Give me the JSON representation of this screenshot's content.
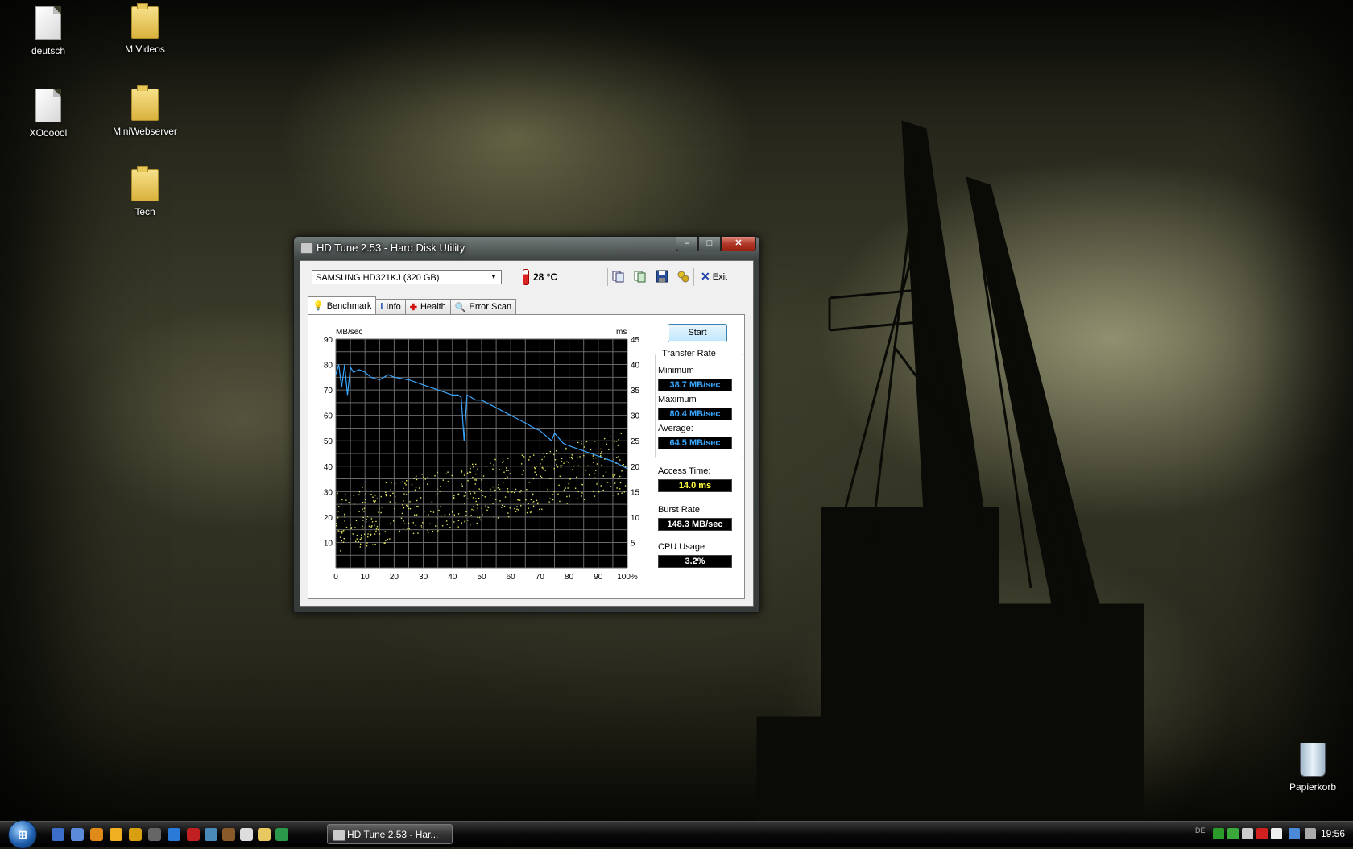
{
  "desktop": {
    "icons": [
      {
        "label": "deutsch",
        "type": "file"
      },
      {
        "label": "M Videos",
        "type": "folder"
      },
      {
        "label": "XOooool",
        "type": "file"
      },
      {
        "label": "MiniWebserver",
        "type": "folder"
      },
      {
        "label": "Tech",
        "type": "folder"
      }
    ],
    "recycle_bin": "Papierkorb"
  },
  "window": {
    "title": "HD Tune 2.53 - Hard Disk Utility",
    "buttons": {
      "minimize": "–",
      "maximize": "□",
      "close": "✕"
    },
    "drive": "SAMSUNG HD321KJ (320 GB)",
    "temperature": "28 °C",
    "exit_label": "Exit",
    "tabs": [
      {
        "label": "Benchmark",
        "icon": "bulb-icon",
        "active": true
      },
      {
        "label": "Info",
        "icon": "info-icon",
        "active": false
      },
      {
        "label": "Health",
        "icon": "health-cross-icon",
        "active": false
      },
      {
        "label": "Error Scan",
        "icon": "magnifier-icon",
        "active": false
      }
    ],
    "start_label": "Start",
    "stats": {
      "transfer_rate_title": "Transfer Rate",
      "minimum_label": "Minimum",
      "minimum_value": "38.7 MB/sec",
      "maximum_label": "Maximum",
      "maximum_value": "80.4 MB/sec",
      "average_label": "Average:",
      "average_value": "64.5 MB/sec",
      "access_label": "Access Time:",
      "access_value": "14.0 ms",
      "burst_label": "Burst Rate",
      "burst_value": "148.3 MB/sec",
      "cpu_label": "CPU Usage",
      "cpu_value": "3.2%"
    }
  },
  "chart_data": {
    "type": "line",
    "y_left_label": "MB/sec",
    "y_right_label": "ms",
    "y_left_ticks": [
      "90",
      "80",
      "70",
      "60",
      "50",
      "40",
      "30",
      "20",
      "10"
    ],
    "y_right_ticks": [
      "45",
      "40",
      "35",
      "30",
      "25",
      "20",
      "15",
      "10",
      "5"
    ],
    "x_ticks": [
      "0",
      "10",
      "20",
      "30",
      "40",
      "50",
      "60",
      "70",
      "80",
      "90",
      "100%"
    ],
    "ylim_left": [
      0,
      90
    ],
    "ylim_right": [
      0,
      45
    ],
    "xlim": [
      0,
      100
    ],
    "grid": true,
    "series": [
      {
        "name": "transfer",
        "color": "#3aa7ff",
        "x": [
          0,
          1,
          2,
          3,
          4,
          5,
          6,
          8,
          10,
          12,
          15,
          18,
          20,
          25,
          30,
          35,
          40,
          42,
          43,
          44,
          45,
          48,
          50,
          55,
          60,
          65,
          68,
          70,
          72,
          73,
          74,
          75,
          78,
          80,
          85,
          90,
          95,
          100
        ],
        "y": [
          76,
          80,
          71,
          80,
          68,
          79,
          77,
          78,
          77,
          75,
          74,
          76,
          75,
          74,
          72,
          70,
          68,
          68,
          67,
          50,
          68,
          66,
          66,
          63,
          60,
          57,
          55,
          54,
          52,
          51,
          50,
          53,
          49,
          48,
          46,
          44,
          42,
          39
        ]
      },
      {
        "name": "access",
        "color": "#e8e860",
        "type": "scatter",
        "range_min": [
          3,
          8,
          6
        ],
        "note_points": "scatter of access time samples, roughly 8–22 ms rising with position"
      }
    ]
  },
  "taskbar": {
    "task_label": "HD Tune 2.53 - Har...",
    "clock": "19:56",
    "lang": "DE"
  }
}
